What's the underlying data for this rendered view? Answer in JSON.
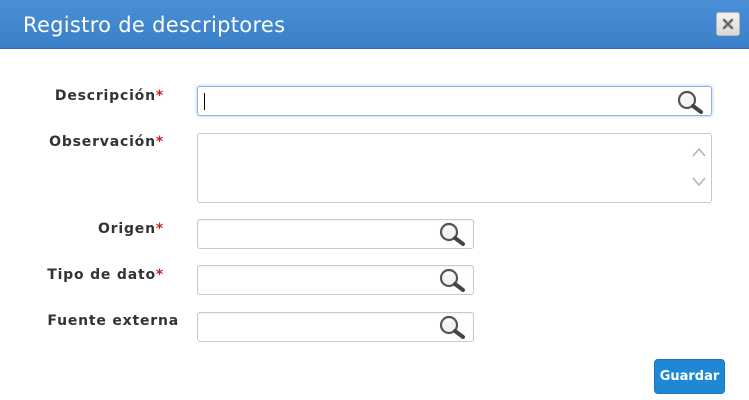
{
  "dialog": {
    "title": "Registro de descriptores",
    "close_icon": "close-icon"
  },
  "form": {
    "required_marker": "*",
    "fields": {
      "descripcion": {
        "label": "Descripción",
        "required": true,
        "value": "",
        "icon": "search-icon"
      },
      "observacion": {
        "label": "Observación",
        "required": true,
        "value": ""
      },
      "origen": {
        "label": "Origen",
        "required": true,
        "value": "",
        "icon": "search-icon"
      },
      "tipo_dato": {
        "label": "Tipo de dato",
        "required": true,
        "value": "",
        "icon": "search-icon"
      },
      "fuente_externa": {
        "label": "Fuente externa",
        "required": false,
        "value": "",
        "icon": "search-icon"
      }
    }
  },
  "actions": {
    "save_label": "Guardar"
  },
  "colors": {
    "titlebar": "#3a80c8",
    "required": "#cc1f1f",
    "primary_button": "#1e88d4"
  }
}
